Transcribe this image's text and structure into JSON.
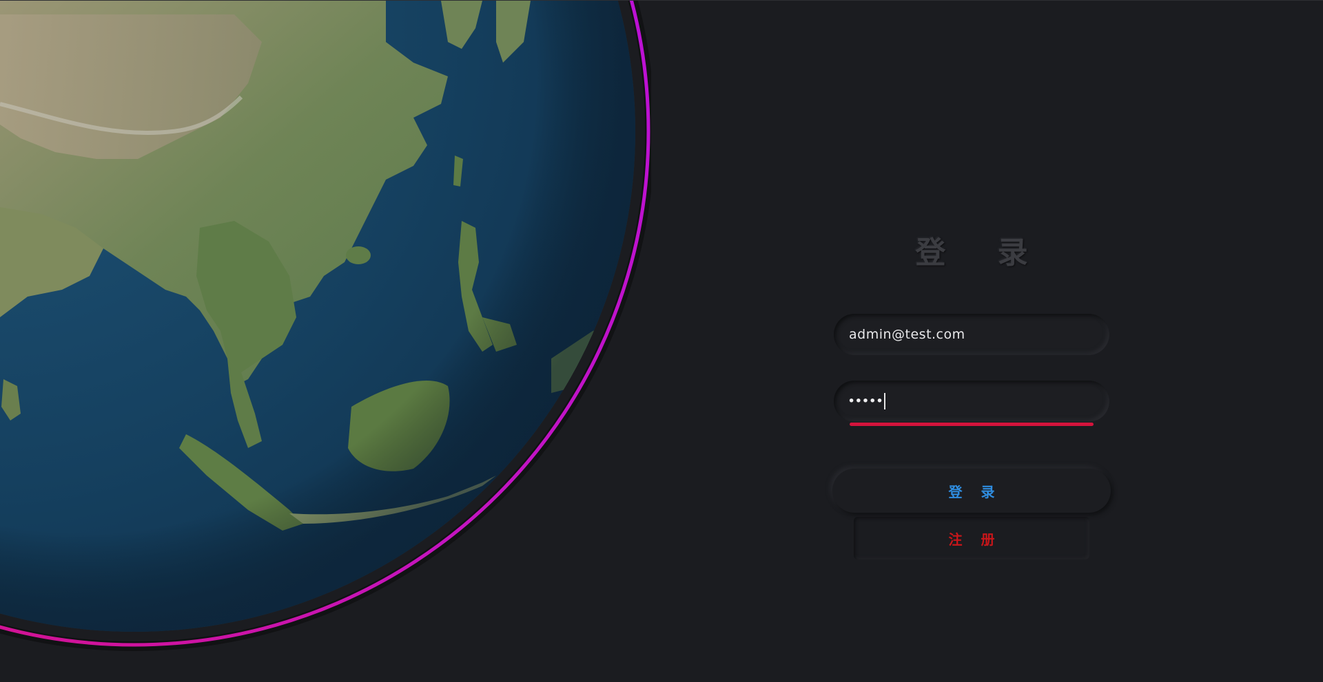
{
  "login": {
    "title": "登 录",
    "email": {
      "value": "admin@test.com",
      "placeholder": ""
    },
    "password": {
      "masked_value": "•••••",
      "has_error": true
    },
    "login_button_label": "登 录",
    "register_button_label": "注 册"
  },
  "colors": {
    "background": "#1b1c20",
    "title": "#3b3c41",
    "login_button_text": "#2f8de0",
    "register_button_text": "#c8161a",
    "error_underline": "#d4143c",
    "globe_ring_start": "#b012d6",
    "globe_ring_end": "#d8127e"
  },
  "globe": {
    "image": "earth-globe-asia"
  }
}
